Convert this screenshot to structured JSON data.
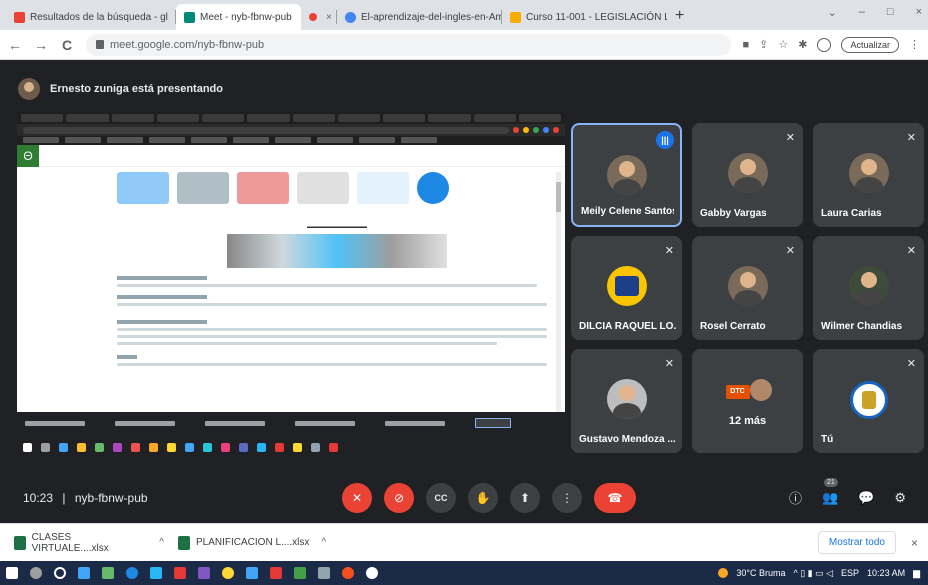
{
  "browser": {
    "tabs": [
      {
        "title": "Resultados de la búsqueda - gl",
        "color": "#ea4335",
        "active": false
      },
      {
        "title": "Meet - nyb-fbnw-pub",
        "color": "#00897b",
        "active": true
      },
      {
        "title": "",
        "color": "#ea4335",
        "active": false
      },
      {
        "title": "El-aprendizaje-del-ingles-en-Am",
        "color": "#4285f4",
        "active": false
      },
      {
        "title": "Curso 11-001 - LEGISLACIÓN LA",
        "color": "#f9ab00",
        "active": false
      }
    ],
    "tab_close": "×",
    "new_tab": "+",
    "window_controls": [
      "⌄",
      "–",
      "□",
      "×"
    ],
    "nav": {
      "back": "←",
      "forward": "→",
      "reload": "C"
    },
    "url": "meet.google.com/nyb-fbnw-pub",
    "update_label": "Actualizar"
  },
  "meet": {
    "presenter_text": "Ernesto zuniga está presentando",
    "time": "10:23",
    "separator": "|",
    "meeting_code": "nyb-fbnw-pub",
    "participants_count": "21",
    "participants": [
      {
        "name": "Meily Celene Santos",
        "state": "speaking"
      },
      {
        "name": "Gabby Vargas",
        "state": "muted"
      },
      {
        "name": "Laura Carias",
        "state": "muted"
      },
      {
        "name": "DILCIA RAQUEL LO...",
        "state": "muted"
      },
      {
        "name": "Rosel Cerrato",
        "state": "muted"
      },
      {
        "name": "Wilmer Chandias",
        "state": "muted"
      },
      {
        "name": "Gustavo Mendoza ...",
        "state": "muted"
      },
      {
        "name": "12 más",
        "state": "more"
      },
      {
        "name": "Tú",
        "state": "muted"
      }
    ],
    "more_badge": "DTC",
    "controls": {
      "mic": "🎤",
      "camera": "📷",
      "captions": "CC",
      "hand": "✋",
      "present": "⬆",
      "more": "⋮",
      "end": "☎"
    },
    "right_controls": {
      "info": "ⓘ",
      "people": "👥",
      "chat": "💬",
      "activities": "⚙"
    }
  },
  "downloads": {
    "items": [
      "CLASES VIRTUALE....xlsx",
      "PLANIFICACION L....xlsx"
    ],
    "show_all": "Mostrar todo",
    "close": "×"
  },
  "taskbar": {
    "weather": "30°C Bruma",
    "lang": "ESP",
    "time": "10:23 AM",
    "icon_colors": [
      "#ffffff",
      "#9e9e9e",
      "#ffffff",
      "#42a5f5",
      "#66bb6a",
      "#1e88e5",
      "#29b6f6",
      "#e53935",
      "#7e57c2",
      "#fdd835",
      "#42a5f5",
      "#e53935",
      "#43a047",
      "#90a4ae",
      "#f4511e",
      "#ffffff"
    ]
  },
  "colors": {
    "meet_bg": "#202124",
    "tile_bg": "#3c4043",
    "end_call": "#ea4335",
    "speaking_border": "#8ab4f8"
  }
}
